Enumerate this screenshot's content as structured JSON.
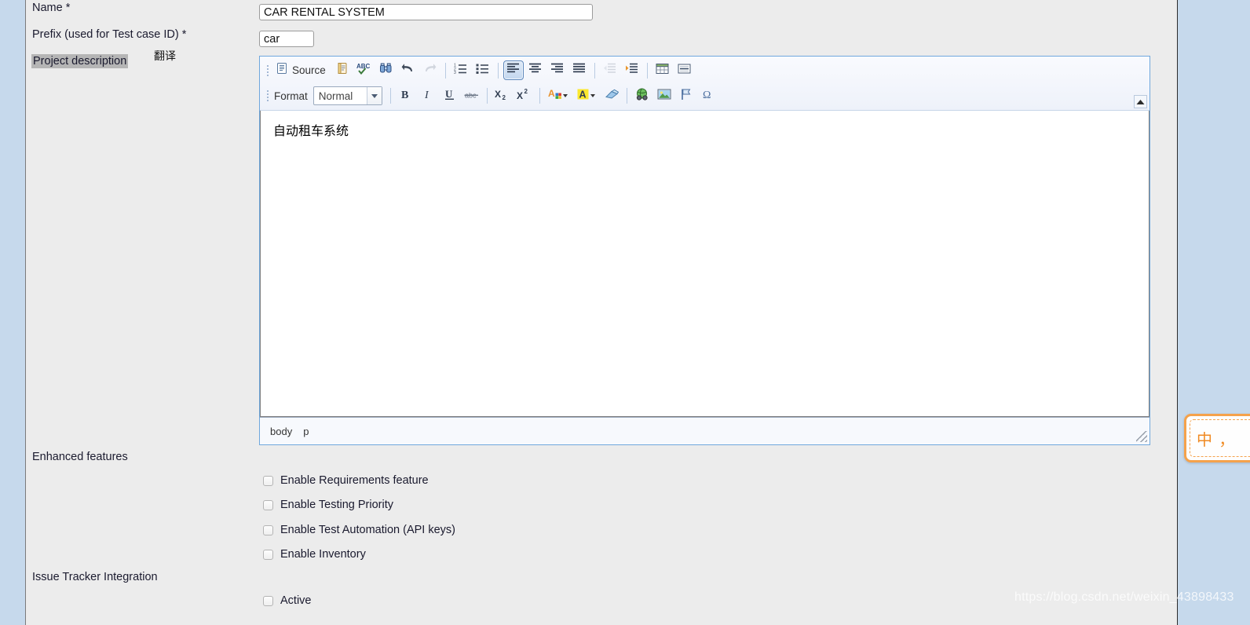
{
  "form": {
    "fields": [
      {
        "label": "Name *",
        "value": "CAR RENTAL SYSTEM"
      },
      {
        "label": "Prefix (used for Test case ID) *",
        "value": "car"
      },
      {
        "label": "Project description"
      }
    ],
    "translate_note": "翻译",
    "section_enhanced": "Enhanced features",
    "section_issue_tracker": "Issue Tracker Integration"
  },
  "editor": {
    "toolbar_row1": [
      {
        "name": "source",
        "label": "Source",
        "icon": "source-icon"
      },
      {
        "name": "templates",
        "label": "Templates",
        "icon": "templates-icon"
      },
      {
        "name": "spellcheck",
        "label": "Check Spelling",
        "icon": "abc-spellcheck-icon"
      },
      {
        "name": "find",
        "label": "Find",
        "icon": "binoculars-find-icon"
      },
      {
        "name": "undo",
        "label": "Undo",
        "icon": "undo-arrow-icon"
      },
      {
        "name": "redo",
        "label": "Redo",
        "icon": "redo-arrow-icon"
      },
      {
        "name": "numbered-list",
        "label": "Insert/Remove Numbered List",
        "icon": "numbered-list-icon"
      },
      {
        "name": "bulleted-list",
        "label": "Insert/Remove Bulleted List",
        "icon": "bulleted-list-icon"
      },
      {
        "name": "align-left",
        "label": "Align Left",
        "icon": "align-left-icon"
      },
      {
        "name": "align-center",
        "label": "Center",
        "icon": "align-center-icon"
      },
      {
        "name": "align-right",
        "label": "Align Right",
        "icon": "align-right-icon"
      },
      {
        "name": "justify",
        "label": "Justify",
        "icon": "justify-icon"
      },
      {
        "name": "outdent",
        "label": "Decrease Indent",
        "icon": "outdent-icon"
      },
      {
        "name": "indent",
        "label": "Increase Indent",
        "icon": "indent-icon"
      },
      {
        "name": "table",
        "label": "Table",
        "icon": "table-icon"
      },
      {
        "name": "horizontal-rule",
        "label": "Insert Horizontal Line",
        "icon": "horizontal-rule-icon"
      }
    ],
    "format_label": "Format",
    "format_value": "Normal",
    "toolbar_row2": [
      {
        "name": "bold",
        "label": "Bold",
        "icon": "bold-icon"
      },
      {
        "name": "italic",
        "label": "Italic",
        "icon": "italic-icon"
      },
      {
        "name": "underline",
        "label": "Underline",
        "icon": "underline-icon"
      },
      {
        "name": "strikethrough",
        "label": "Strike Through",
        "icon": "strikethrough-icon"
      },
      {
        "name": "subscript",
        "label": "Subscript",
        "icon": "subscript-icon"
      },
      {
        "name": "superscript",
        "label": "Superscript",
        "icon": "superscript-icon"
      },
      {
        "name": "text-color",
        "label": "Text Color",
        "icon": "text-color-icon"
      },
      {
        "name": "background-color",
        "label": "Background Color",
        "icon": "background-color-icon"
      },
      {
        "name": "remove-format",
        "label": "Remove Format",
        "icon": "eraser-icon"
      },
      {
        "name": "link",
        "label": "Link",
        "icon": "globe-link-icon"
      },
      {
        "name": "image",
        "label": "Image",
        "icon": "image-icon"
      },
      {
        "name": "anchor",
        "label": "Anchor",
        "icon": "flag-anchor-icon"
      },
      {
        "name": "special-char",
        "label": "Insert Special Character",
        "icon": "omega-icon"
      }
    ],
    "content": "自动租车系统",
    "element_path": [
      "body",
      "p"
    ],
    "active_button": "align-left",
    "disabled_buttons": [
      "redo",
      "outdent"
    ]
  },
  "checkboxes": {
    "enhanced": [
      {
        "label": "Enable Requirements feature",
        "checked": false
      },
      {
        "label": "Enable Testing Priority",
        "checked": false
      },
      {
        "label": "Enable Test Automation (API keys)",
        "checked": false
      },
      {
        "label": "Enable Inventory",
        "checked": false
      }
    ],
    "issue_tracker": [
      {
        "label": "Active",
        "checked": false
      }
    ]
  },
  "ime_widget": {
    "glyphs": "中 ，"
  },
  "watermark": "https://blog.csdn.net/weixin_43898433",
  "colors": {
    "gutter": "#c6d9ec",
    "form_bg": "#ececec",
    "editor_border": "#6fa7dd",
    "accent_orange": "#f5a24b"
  }
}
